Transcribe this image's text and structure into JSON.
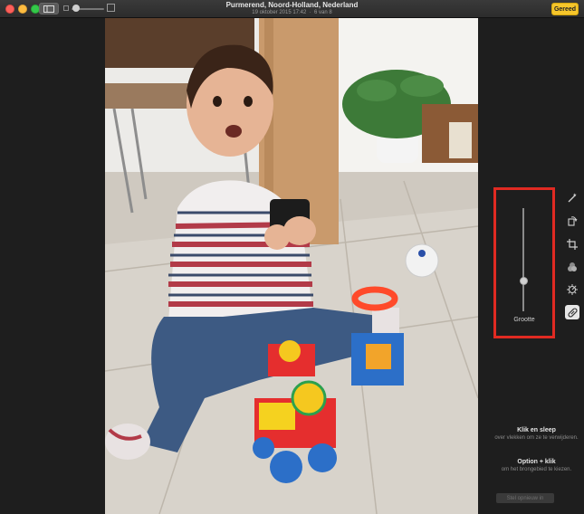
{
  "window": {
    "title": "Purmerend, Noord-Holland, Nederland",
    "subtitle": "19 oktober 2015 17:42  ·  6 van 8",
    "done_label": "Gereed"
  },
  "toolbar": {
    "view_icon": "thumbnail-grid-icon",
    "zoom_small_icon": "small-photo-icon",
    "zoom_large_icon": "large-photo-icon",
    "zoom_level": 0.05
  },
  "retouch": {
    "size_label": "Grootte",
    "size_value": 0.3,
    "help": [
      {
        "title": "Klik en sleep",
        "desc": "over vlekken om ze te verwijderen."
      },
      {
        "title": "Option + klik",
        "desc": "om het brongebied te kiezen."
      }
    ],
    "reset_label": "Stel opnieuw in"
  },
  "tools": [
    {
      "icon": "magic-wand-icon",
      "active": false
    },
    {
      "icon": "rotate-icon",
      "active": false
    },
    {
      "icon": "crop-icon",
      "active": false
    },
    {
      "icon": "filters-icon",
      "active": false
    },
    {
      "icon": "adjust-icon",
      "active": false
    },
    {
      "icon": "retouch-bandage-icon",
      "active": true
    }
  ],
  "colors": {
    "accent": "#f5c52b",
    "highlight": "#e02a22",
    "background": "#1e1e1e"
  }
}
